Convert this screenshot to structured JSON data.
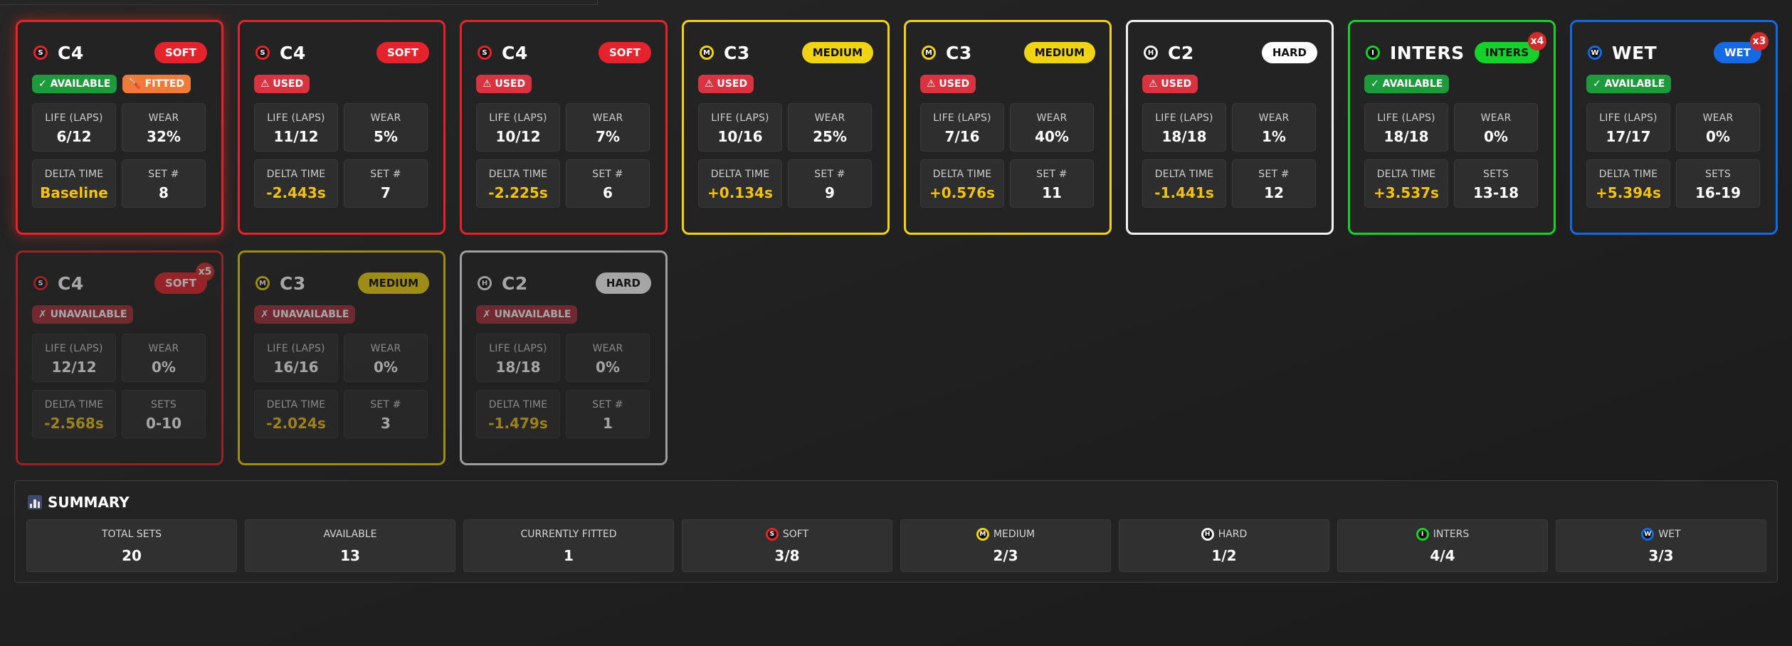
{
  "colors": {
    "soft": "#e5232d",
    "medium": "#f0d312",
    "hard": "#f2f2f2",
    "inters": "#16d12c",
    "wet": "#1569e3"
  },
  "cards": [
    {
      "compound": "soft",
      "letter": "S",
      "name": "C4",
      "badge": "SOFT",
      "tags": [
        {
          "type": "available",
          "text": "✓ AVAILABLE"
        },
        {
          "type": "fitted",
          "text": "🪛 FITTED"
        }
      ],
      "stats": [
        {
          "label": "LIFE (LAPS)",
          "value": "6/12"
        },
        {
          "label": "WEAR",
          "value": "32%"
        },
        {
          "label": "DELTA TIME",
          "value": "Baseline"
        },
        {
          "label": "SET #",
          "value": "8"
        }
      ]
    },
    {
      "compound": "soft",
      "letter": "S",
      "name": "C4",
      "badge": "SOFT",
      "tags": [
        {
          "type": "used",
          "text": "⚠ USED"
        }
      ],
      "stats": [
        {
          "label": "LIFE (LAPS)",
          "value": "11/12"
        },
        {
          "label": "WEAR",
          "value": "5%"
        },
        {
          "label": "DELTA TIME",
          "value": "-2.443s"
        },
        {
          "label": "SET #",
          "value": "7"
        }
      ]
    },
    {
      "compound": "soft",
      "letter": "S",
      "name": "C4",
      "badge": "SOFT",
      "tags": [
        {
          "type": "used",
          "text": "⚠ USED"
        }
      ],
      "stats": [
        {
          "label": "LIFE (LAPS)",
          "value": "10/12"
        },
        {
          "label": "WEAR",
          "value": "7%"
        },
        {
          "label": "DELTA TIME",
          "value": "-2.225s"
        },
        {
          "label": "SET #",
          "value": "6"
        }
      ]
    },
    {
      "compound": "medium",
      "letter": "M",
      "name": "C3",
      "badge": "MEDIUM",
      "tags": [
        {
          "type": "used",
          "text": "⚠ USED"
        }
      ],
      "stats": [
        {
          "label": "LIFE (LAPS)",
          "value": "10/16"
        },
        {
          "label": "WEAR",
          "value": "25%"
        },
        {
          "label": "DELTA TIME",
          "value": "+0.134s"
        },
        {
          "label": "SET #",
          "value": "9"
        }
      ]
    },
    {
      "compound": "medium",
      "letter": "M",
      "name": "C3",
      "badge": "MEDIUM",
      "tags": [
        {
          "type": "used",
          "text": "⚠ USED"
        }
      ],
      "stats": [
        {
          "label": "LIFE (LAPS)",
          "value": "7/16"
        },
        {
          "label": "WEAR",
          "value": "40%"
        },
        {
          "label": "DELTA TIME",
          "value": "+0.576s"
        },
        {
          "label": "SET #",
          "value": "11"
        }
      ]
    },
    {
      "compound": "hard",
      "letter": "H",
      "name": "C2",
      "badge": "HARD",
      "tags": [
        {
          "type": "used",
          "text": "⚠ USED"
        }
      ],
      "stats": [
        {
          "label": "LIFE (LAPS)",
          "value": "18/18"
        },
        {
          "label": "WEAR",
          "value": "1%"
        },
        {
          "label": "DELTA TIME",
          "value": "-1.441s"
        },
        {
          "label": "SET #",
          "value": "12"
        }
      ]
    },
    {
      "compound": "inters",
      "letter": "I",
      "name": "INTERS",
      "badge": "INTERS",
      "count": "x4",
      "tags": [
        {
          "type": "available",
          "text": "✓ AVAILABLE"
        }
      ],
      "stats": [
        {
          "label": "LIFE (LAPS)",
          "value": "18/18"
        },
        {
          "label": "WEAR",
          "value": "0%"
        },
        {
          "label": "DELTA TIME",
          "value": "+3.537s"
        },
        {
          "label": "SETS",
          "value": "13-18"
        }
      ]
    },
    {
      "compound": "wet",
      "letter": "W",
      "name": "WET",
      "badge": "WET",
      "count": "x3",
      "tags": [
        {
          "type": "available",
          "text": "✓ AVAILABLE"
        }
      ],
      "stats": [
        {
          "label": "LIFE (LAPS)",
          "value": "17/17"
        },
        {
          "label": "WEAR",
          "value": "0%"
        },
        {
          "label": "DELTA TIME",
          "value": "+5.394s"
        },
        {
          "label": "SETS",
          "value": "16-19"
        }
      ]
    },
    {
      "compound": "soft",
      "letter": "S",
      "name": "C4",
      "badge": "SOFT",
      "count": "x5",
      "tags": [
        {
          "type": "unavailable",
          "text": "✗ UNAVAILABLE"
        }
      ],
      "stats": [
        {
          "label": "LIFE (LAPS)",
          "value": "12/12"
        },
        {
          "label": "WEAR",
          "value": "0%"
        },
        {
          "label": "DELTA TIME",
          "value": "-2.568s"
        },
        {
          "label": "SETS",
          "value": "0-10"
        }
      ]
    },
    {
      "compound": "medium",
      "letter": "M",
      "name": "C3",
      "badge": "MEDIUM",
      "tags": [
        {
          "type": "unavailable",
          "text": "✗ UNAVAILABLE"
        }
      ],
      "stats": [
        {
          "label": "LIFE (LAPS)",
          "value": "16/16"
        },
        {
          "label": "WEAR",
          "value": "0%"
        },
        {
          "label": "DELTA TIME",
          "value": "-2.024s"
        },
        {
          "label": "SET #",
          "value": "3"
        }
      ]
    },
    {
      "compound": "hard",
      "letter": "H",
      "name": "C2",
      "badge": "HARD",
      "tags": [
        {
          "type": "unavailable",
          "text": "✗ UNAVAILABLE"
        }
      ],
      "stats": [
        {
          "label": "LIFE (LAPS)",
          "value": "18/18"
        },
        {
          "label": "WEAR",
          "value": "0%"
        },
        {
          "label": "DELTA TIME",
          "value": "-1.479s"
        },
        {
          "label": "SET #",
          "value": "1"
        }
      ]
    }
  ],
  "summary": {
    "title": "SUMMARY",
    "icon": "bar-chart-icon",
    "items": [
      {
        "label": "TOTAL SETS",
        "value": "20"
      },
      {
        "label": "AVAILABLE",
        "value": "13"
      },
      {
        "label": "CURRENTLY FITTED",
        "value": "1"
      },
      {
        "label": "SOFT",
        "letter": "S",
        "compound": "soft",
        "value": "3/8"
      },
      {
        "label": "MEDIUM",
        "letter": "M",
        "compound": "medium",
        "value": "2/3"
      },
      {
        "label": "HARD",
        "letter": "H",
        "compound": "hard",
        "value": "1/2"
      },
      {
        "label": "INTERS",
        "letter": "I",
        "compound": "inters",
        "value": "4/4"
      },
      {
        "label": "WET",
        "letter": "W",
        "compound": "wet",
        "value": "3/3"
      }
    ]
  }
}
